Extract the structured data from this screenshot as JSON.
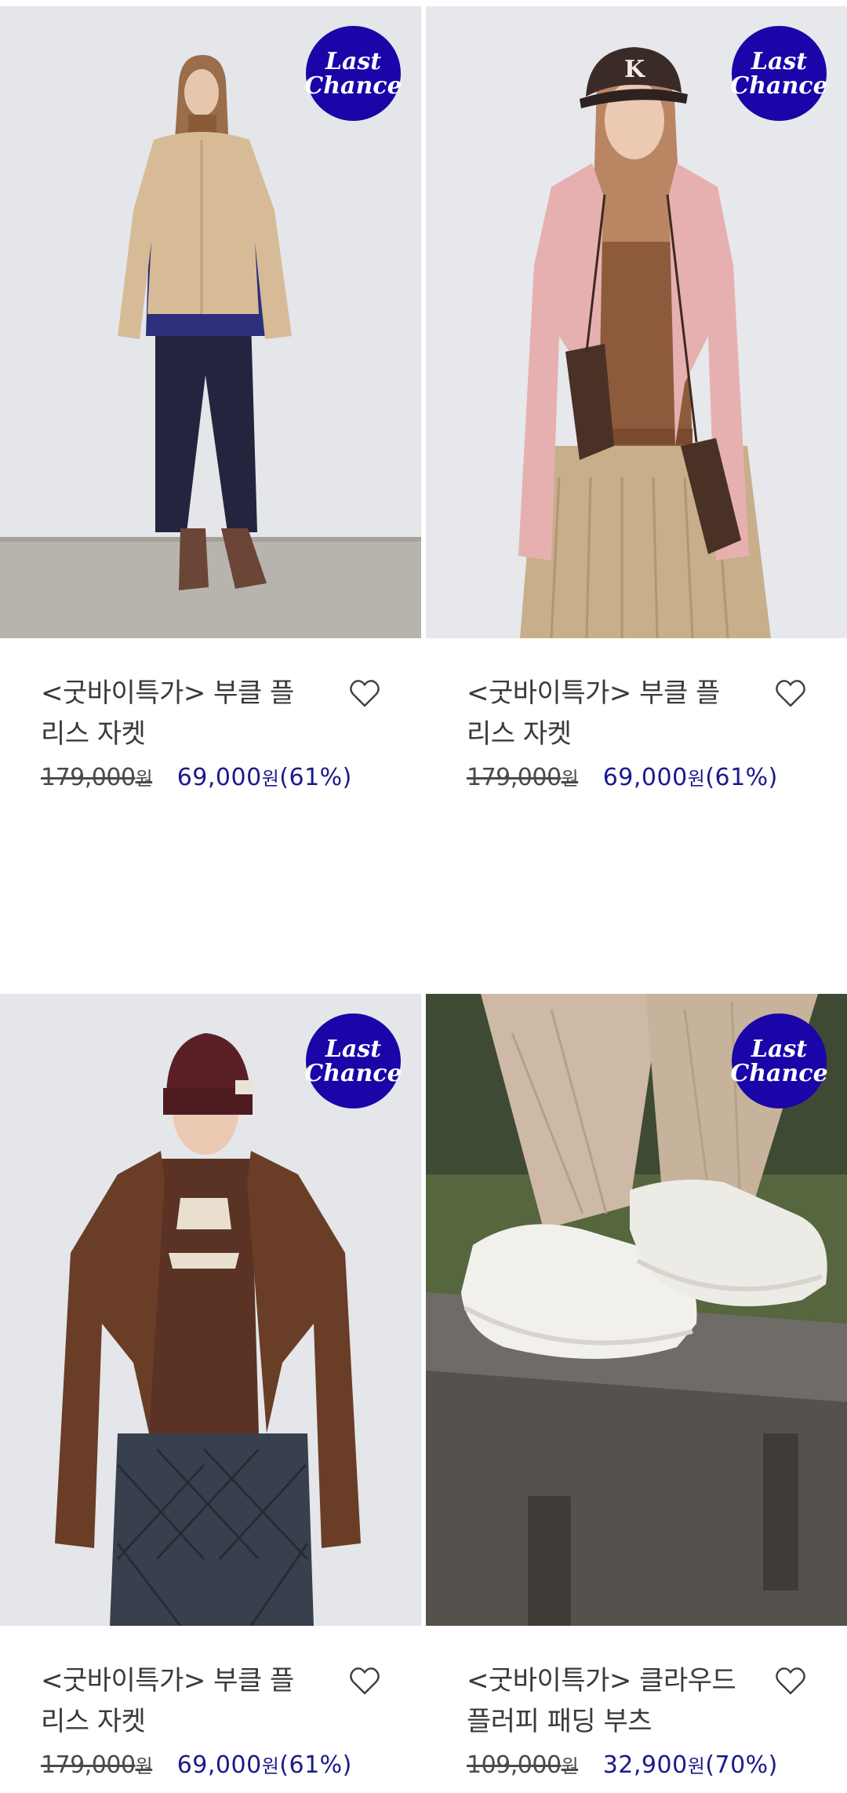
{
  "badge": {
    "line1": "Last",
    "line2": "Chance"
  },
  "colors": {
    "badge_bg": "#1a05a8",
    "sale_price": "#1a1a8c",
    "photo_bg": "#e3e5e9"
  },
  "products": [
    {
      "title": "<굿바이특가> 부클 플리스 자켓",
      "original_price": "179,000",
      "original_unit": "원",
      "sale_price": "69,000",
      "sale_unit": "원",
      "discount": "(61%)",
      "image": "model-beige-boucle-fleece-jacket",
      "icon": "heart-outline-icon"
    },
    {
      "title": "<굿바이특가> 부클 플리스 자켓",
      "original_price": "179,000",
      "original_unit": "원",
      "sale_price": "69,000",
      "sale_unit": "원",
      "discount": "(61%)",
      "image": "model-pink-boucle-fleece-jacket",
      "icon": "heart-outline-icon"
    },
    {
      "title": "<굿바이특가> 부클 플리스 자켓",
      "original_price": "179,000",
      "original_unit": "원",
      "sale_price": "69,000",
      "sale_unit": "원",
      "discount": "(61%)",
      "image": "model-brown-boucle-fleece-jacket",
      "icon": "heart-outline-icon"
    },
    {
      "title": "<굿바이특가> 클라우드 플러피 패딩 부츠",
      "original_price": "109,000",
      "original_unit": "원",
      "sale_price": "32,900",
      "sale_unit": "원",
      "discount": "(70%)",
      "image": "ivory-padded-boots-on-bench",
      "icon": "heart-outline-icon"
    }
  ]
}
